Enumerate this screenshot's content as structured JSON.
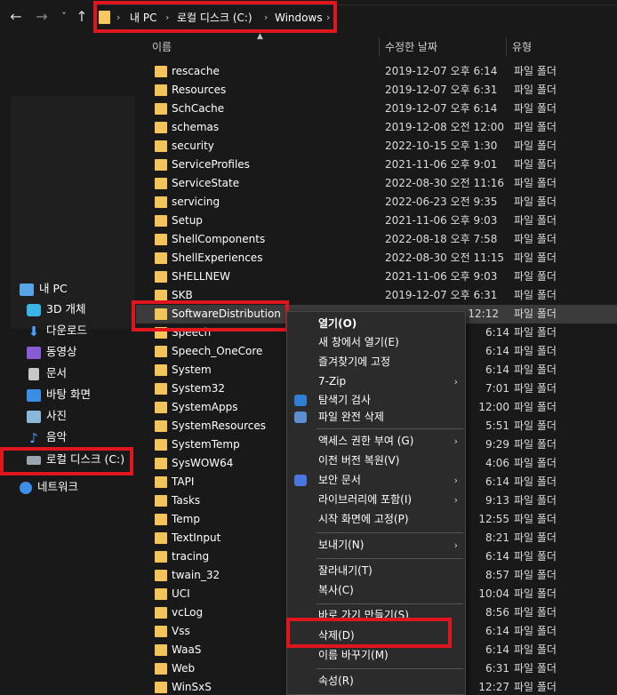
{
  "address": {
    "crumbs": [
      "내 PC",
      "로컬 디스크 (C:)",
      "Windows"
    ],
    "sep": "›"
  },
  "nav": {
    "back": "←",
    "forward": "→",
    "recent": "˅",
    "up": "↑"
  },
  "columns": {
    "name": "이름",
    "modified": "수정한 날짜",
    "type": "유형"
  },
  "sidebar": {
    "items": [
      {
        "label": "내 PC",
        "icon": "pc-icon"
      },
      {
        "label": "3D 개체",
        "icon": "3d-objects-icon"
      },
      {
        "label": "다운로드",
        "icon": "download-icon"
      },
      {
        "label": "동영상",
        "icon": "video-icon"
      },
      {
        "label": "문서",
        "icon": "document-icon"
      },
      {
        "label": "바탕 화면",
        "icon": "desktop-icon"
      },
      {
        "label": "사진",
        "icon": "pictures-icon"
      },
      {
        "label": "음악",
        "icon": "music-icon"
      },
      {
        "label": "로컬 디스크 (C:)",
        "icon": "local-disk-icon"
      },
      {
        "label": "네트워크",
        "icon": "network-icon"
      }
    ]
  },
  "files": [
    {
      "name": "rescache",
      "date": "2019-12-07 오후 6:14",
      "type": "파일 폴더"
    },
    {
      "name": "Resources",
      "date": "2019-12-07 오후 6:31",
      "type": "파일 폴더"
    },
    {
      "name": "SchCache",
      "date": "2019-12-07 오후 6:14",
      "type": "파일 폴더"
    },
    {
      "name": "schemas",
      "date": "2019-12-08 오전 12:00",
      "type": "파일 폴더"
    },
    {
      "name": "security",
      "date": "2022-10-15 오후 1:30",
      "type": "파일 폴더"
    },
    {
      "name": "ServiceProfiles",
      "date": "2021-11-06 오후 9:01",
      "type": "파일 폴더"
    },
    {
      "name": "ServiceState",
      "date": "2022-08-30 오전 11:16",
      "type": "파일 폴더"
    },
    {
      "name": "servicing",
      "date": "2022-06-23 오전 9:35",
      "type": "파일 폴더"
    },
    {
      "name": "Setup",
      "date": "2021-11-06 오후 9:03",
      "type": "파일 폴더"
    },
    {
      "name": "ShellComponents",
      "date": "2022-08-18 오후 7:58",
      "type": "파일 폴더"
    },
    {
      "name": "ShellExperiences",
      "date": "2022-08-30 오전 11:15",
      "type": "파일 폴더"
    },
    {
      "name": "SHELLNEW",
      "date": "2021-11-06 오후 9:03",
      "type": "파일 폴더"
    },
    {
      "name": "SKB",
      "date": "2019-12-07 오후 6:31",
      "type": "파일 폴더"
    },
    {
      "name": "SoftwareDistribution",
      "date": "12:12",
      "type": "파일 폴더"
    },
    {
      "name": "Speech",
      "date": "6:14",
      "type": "파일 폴더"
    },
    {
      "name": "Speech_OneCore",
      "date": "6:14",
      "type": "파일 폴더"
    },
    {
      "name": "System",
      "date": "6:14",
      "type": "파일 폴더"
    },
    {
      "name": "System32",
      "date": "7:01",
      "type": "파일 폴더"
    },
    {
      "name": "SystemApps",
      "date": "12:00",
      "type": "파일 폴더"
    },
    {
      "name": "SystemResources",
      "date": "5:51",
      "type": "파일 폴더"
    },
    {
      "name": "SystemTemp",
      "date": "9:29",
      "type": "파일 폴더"
    },
    {
      "name": "SysWOW64",
      "date": "4:06",
      "type": "파일 폴더"
    },
    {
      "name": "TAPI",
      "date": "6:14",
      "type": "파일 폴더"
    },
    {
      "name": "Tasks",
      "date": "9:13",
      "type": "파일 폴더"
    },
    {
      "name": "Temp",
      "date": "12:55",
      "type": "파일 폴더"
    },
    {
      "name": "TextInput",
      "date": "8:21",
      "type": "파일 폴더"
    },
    {
      "name": "tracing",
      "date": "6:14",
      "type": "파일 폴더"
    },
    {
      "name": "twain_32",
      "date": "8:57",
      "type": "파일 폴더"
    },
    {
      "name": "UCI",
      "date": "10:04",
      "type": "파일 폴더"
    },
    {
      "name": "vcLog",
      "date": "8:56",
      "type": "파일 폴더"
    },
    {
      "name": "Vss",
      "date": "6:14",
      "type": "파일 폴더"
    },
    {
      "name": "WaaS",
      "date": "6:14",
      "type": "파일 폴더"
    },
    {
      "name": "Web",
      "date": "6:31",
      "type": "파일 폴더"
    },
    {
      "name": "WinSxS",
      "date": "12:27",
      "type": "파일 폴더"
    }
  ],
  "context_menu": {
    "open": "열기(O)",
    "open_new_window": "새 창에서 열기(E)",
    "pin_quick": "즐겨찾기에 고정",
    "zip": "7-Zip",
    "scan": "탐색기 검사",
    "shred": "파일 완전 삭제",
    "give_access": "액세스 권한 부여 (G)",
    "restore_prev": "이전 버전 복원(V)",
    "secure_doc": "보안 문서",
    "include_library": "라이브러리에 포함(I)",
    "pin_start": "시작 화면에 고정(P)",
    "send_to": "보내기(N)",
    "cut": "잘라내기(T)",
    "copy": "복사(C)",
    "create_shortcut": "바로 가기 만들기(S)",
    "delete": "삭제(D)",
    "rename": "이름 바꾸기(M)",
    "properties": "속성(R)",
    "submenu_arrow": "›"
  },
  "colors": {
    "highlight_box": "#e0161f",
    "folder": "#f3c45a",
    "background": "#191919",
    "menu_bg": "#2b2b2b"
  }
}
